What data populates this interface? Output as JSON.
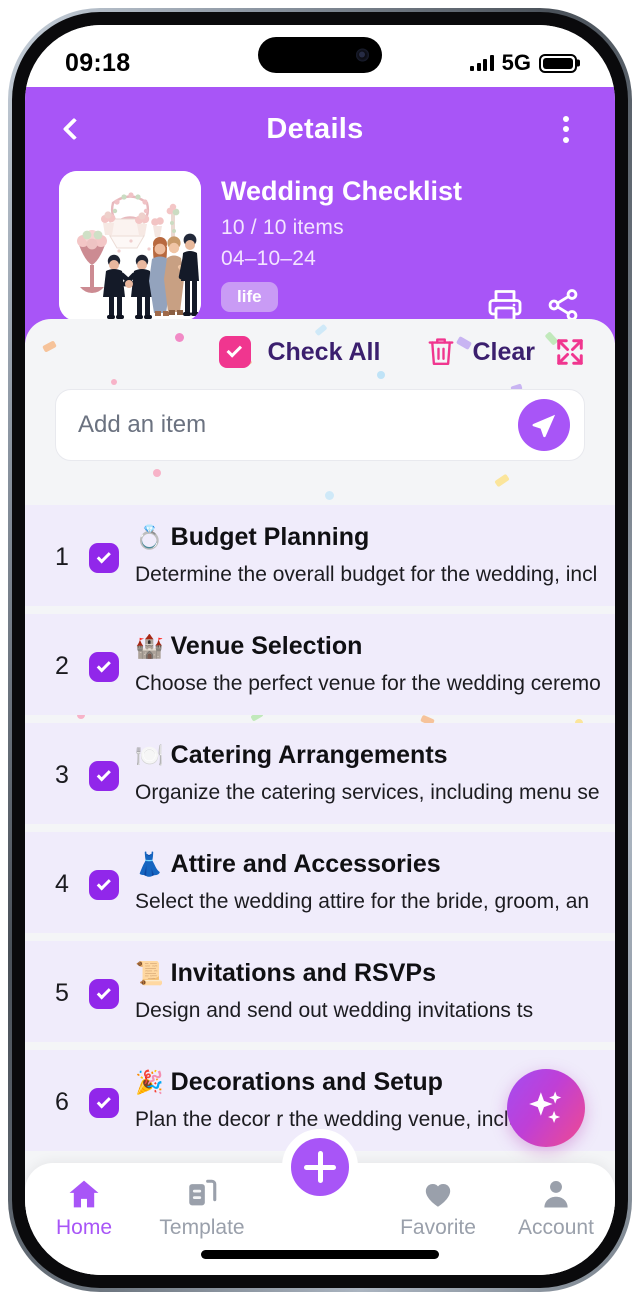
{
  "status_bar": {
    "time": "09:18",
    "network": "5G",
    "signal_icon": "signal-bars-icon",
    "battery_icon": "battery-full-icon"
  },
  "header": {
    "back_icon": "chevron-left-icon",
    "title": "Details",
    "menu_icon": "more-vertical-icon",
    "thumbnail_icon": "wedding-illustration",
    "card": {
      "title": "Wedding Checklist",
      "items_count": "10 / 10 items",
      "date": "04–10–24",
      "tag": "life"
    },
    "actions": [
      {
        "name": "print-icon",
        "label": "Print"
      },
      {
        "name": "share-icon",
        "label": "Share"
      }
    ],
    "background_color": "#a855f7"
  },
  "toolbar": {
    "check_all_label": "Check All",
    "check_all_icon": "checkbox-checked-icon",
    "clear_label": "Clear",
    "clear_icon": "trash-icon",
    "expand_icon": "expand-arrows-icon",
    "accent_color": "#f0368f"
  },
  "add_item": {
    "placeholder": "Add an item",
    "value": "",
    "send_icon": "send-paper-plane-icon"
  },
  "checklist": [
    {
      "index": "1",
      "emoji": "💍",
      "title": "Budget Planning",
      "description": "Determine the overall budget for the wedding, incl",
      "checked": true
    },
    {
      "index": "2",
      "emoji": "🏰",
      "title": "Venue Selection",
      "description": "Choose the perfect venue for the wedding ceremo",
      "checked": true
    },
    {
      "index": "3",
      "emoji": "🍽️",
      "title": "Catering Arrangements",
      "description": "Organize the catering services, including menu se",
      "checked": true
    },
    {
      "index": "4",
      "emoji": "👗",
      "title": "Attire and Accessories",
      "description": "Select the wedding attire for the bride, groom, an",
      "checked": true
    },
    {
      "index": "5",
      "emoji": "📜",
      "title": "Invitations and RSVPs",
      "description": "Design and send out wedding invitations  ts",
      "checked": true
    },
    {
      "index": "6",
      "emoji": "🎉",
      "title": "Decorations and Setup",
      "description": "Plan the decor             r the wedding venue, inclu",
      "checked": true
    }
  ],
  "ai_fab": {
    "icon": "sparkles-icon"
  },
  "bottom_nav": {
    "items": [
      {
        "label": "Home",
        "icon": "home-icon",
        "active": true
      },
      {
        "label": "Template",
        "icon": "template-icon",
        "active": false
      },
      {
        "label": "Favorite",
        "icon": "heart-icon",
        "active": false
      },
      {
        "label": "Account",
        "icon": "person-icon",
        "active": false
      }
    ],
    "add_button_icon": "plus-icon",
    "active_color": "#a855f7",
    "inactive_color": "#9aa0ab"
  }
}
